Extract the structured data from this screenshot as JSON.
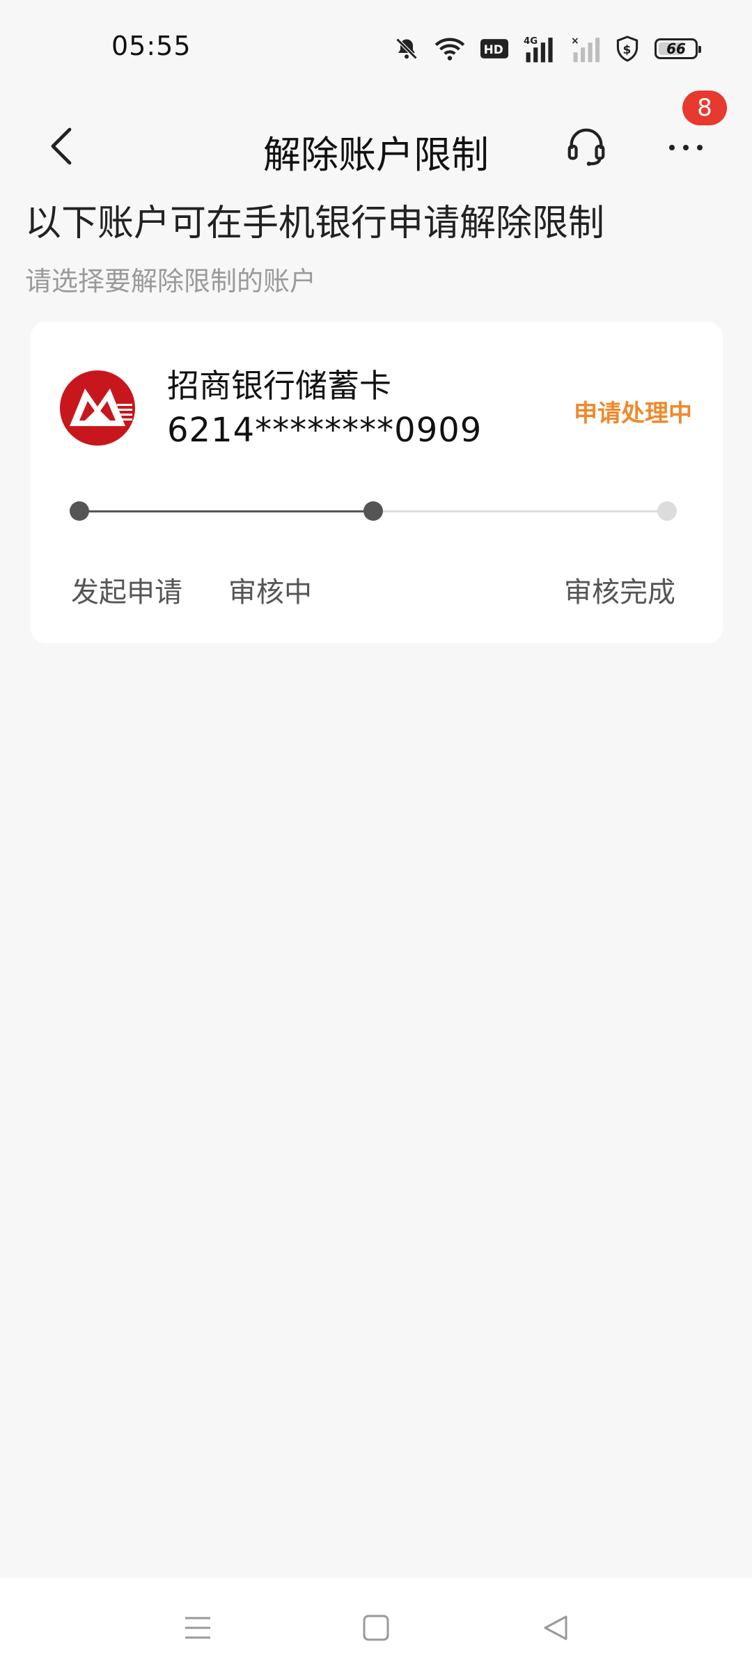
{
  "status_bar": {
    "time": "05:55",
    "battery": "66",
    "icons": [
      "bell-off-icon",
      "wifi-icon",
      "hd-icon",
      "signal-4g-icon",
      "signal-icon",
      "shield-icon",
      "battery-icon"
    ]
  },
  "nav": {
    "title": "解除账户限制",
    "more_badge": "8"
  },
  "heading": "以下账户可在手机银行申请解除限制",
  "subheading": "请选择要解除限制的账户",
  "account": {
    "bank_name": "招商银行储蓄卡",
    "card_number": "6214********0909",
    "status": "申请处理中",
    "progress": {
      "current_step": 2,
      "total_steps": 3
    },
    "steps": [
      {
        "label": "发起申请"
      },
      {
        "label": "审核中"
      },
      {
        "label": "审核完成"
      }
    ]
  },
  "colors": {
    "accent": "#f0882b",
    "badge": "#e8392e",
    "logo": "#c8161d",
    "step_done": "#555555",
    "step_todo": "#dcdcdc"
  }
}
